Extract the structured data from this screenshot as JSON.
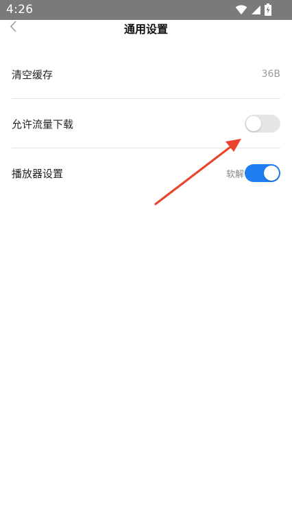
{
  "status_bar": {
    "time": "4:26",
    "icons": [
      "wifi-icon",
      "cellular-icon",
      "battery-charging-icon"
    ]
  },
  "header": {
    "title": "通用设置",
    "back_icon": "chevron-left-icon"
  },
  "settings": [
    {
      "label": "清空缓存",
      "value": "36B"
    },
    {
      "label": "允许流量下载",
      "toggle_on": false
    },
    {
      "label": "播放器设置",
      "sub_label": "软解",
      "toggle_on": true
    }
  ],
  "colors": {
    "status_bar": "#7a7a7a",
    "toggle_on": "#1f7df2",
    "toggle_off": "#e6e6e6",
    "annotation_arrow": "#e8452c"
  },
  "annotation": {
    "icon": "red-arrow-annotation"
  }
}
